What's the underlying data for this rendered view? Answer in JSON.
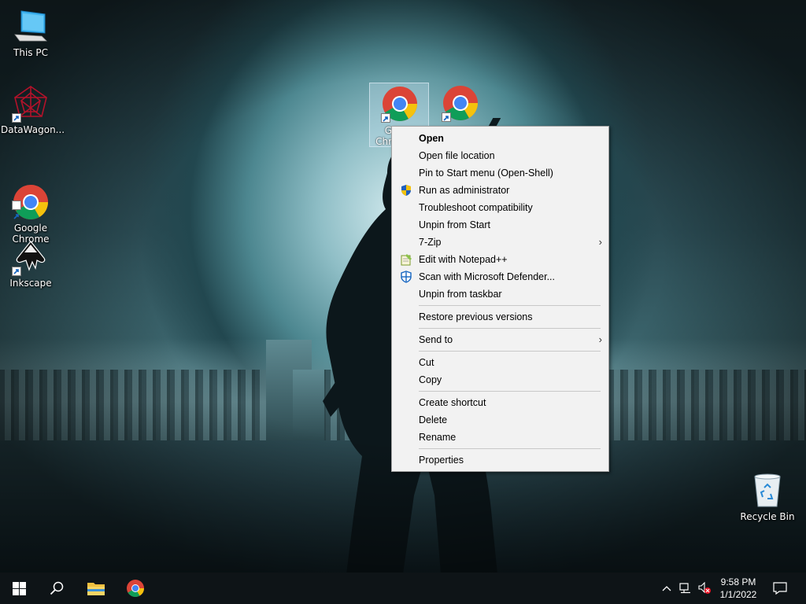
{
  "desktop": {
    "icons": [
      {
        "label": "This PC",
        "icon": "this-pc-icon"
      },
      {
        "label": "DataWagon...",
        "icon": "datawagon-icon"
      },
      {
        "label": "Google\nChrome",
        "icon": "chrome-icon"
      },
      {
        "label": "Inkscape",
        "icon": "inkscape-icon"
      },
      {
        "label": "Recycle Bin",
        "icon": "recycle-bin-icon"
      }
    ],
    "selected_icon_label": "Google Chrome",
    "selected_icon_partial": [
      "G",
      "Chr"
    ]
  },
  "context_menu": {
    "items": [
      {
        "label": "Open",
        "bold": true
      },
      {
        "label": "Open file location"
      },
      {
        "label": "Pin to Start menu (Open-Shell)"
      },
      {
        "label": "Run as administrator",
        "icon": "uac-shield-icon"
      },
      {
        "label": "Troubleshoot compatibility"
      },
      {
        "label": "Unpin from Start"
      },
      {
        "label": "7-Zip",
        "submenu": true
      },
      {
        "label": "Edit with Notepad++",
        "icon": "notepadpp-icon"
      },
      {
        "label": "Scan with Microsoft Defender...",
        "icon": "defender-icon"
      },
      {
        "label": "Unpin from taskbar"
      },
      {
        "label": "Restore previous versions"
      },
      {
        "label": "Send to",
        "submenu": true
      },
      {
        "label": "Cut"
      },
      {
        "label": "Copy"
      },
      {
        "label": "Create shortcut"
      },
      {
        "label": "Delete"
      },
      {
        "label": "Rename"
      },
      {
        "label": "Properties"
      }
    ],
    "submenu_arrow": "›"
  },
  "taskbar": {
    "pinned": [
      "start-icon",
      "search-icon",
      "file-explorer-icon",
      "chrome-icon"
    ],
    "tray": {
      "time": "9:58 PM",
      "date": "1/1/2022",
      "icons": [
        "chevron-up-icon",
        "network-icon",
        "volume-muted-icon",
        "notifications-icon"
      ]
    }
  },
  "colors": {
    "menu_bg": "#f2f2f2",
    "taskbar_bg": "#0e1417",
    "chrome_red": "#db4437",
    "chrome_yellow": "#f4c20d",
    "chrome_green": "#0f9d58",
    "chrome_blue": "#4285f4"
  }
}
